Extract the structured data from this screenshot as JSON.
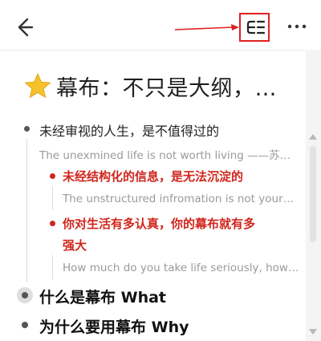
{
  "header": {
    "back_icon": "back-arrow-icon",
    "outline_icon": "outline-structure-icon",
    "more_icon": "more-dots-icon",
    "annotation_color": "#e02020"
  },
  "document": {
    "title_icon": "star-icon",
    "title": "幕布：不只是大纲，…",
    "nodes": [
      {
        "text": "未经审视的人生，是不值得过的",
        "note": "The unexmined life is not worth living ——苏…",
        "children": [
          {
            "text": "未经结构化的信息，是无法沉淀的",
            "note": "The unstructured infromation is not your…"
          },
          {
            "text_line1": "你对生活有多认真，你的幕布就有多",
            "text_line2": "强大",
            "note": "How much do you take life seriously, how…"
          }
        ]
      },
      {
        "text": "什么是幕布 What"
      },
      {
        "text": "为什么要用幕布 Why"
      }
    ]
  },
  "colors": {
    "accent_red": "#d0261d",
    "note_gray": "#9a9a9a",
    "star_yellow": "#f6c22b"
  }
}
